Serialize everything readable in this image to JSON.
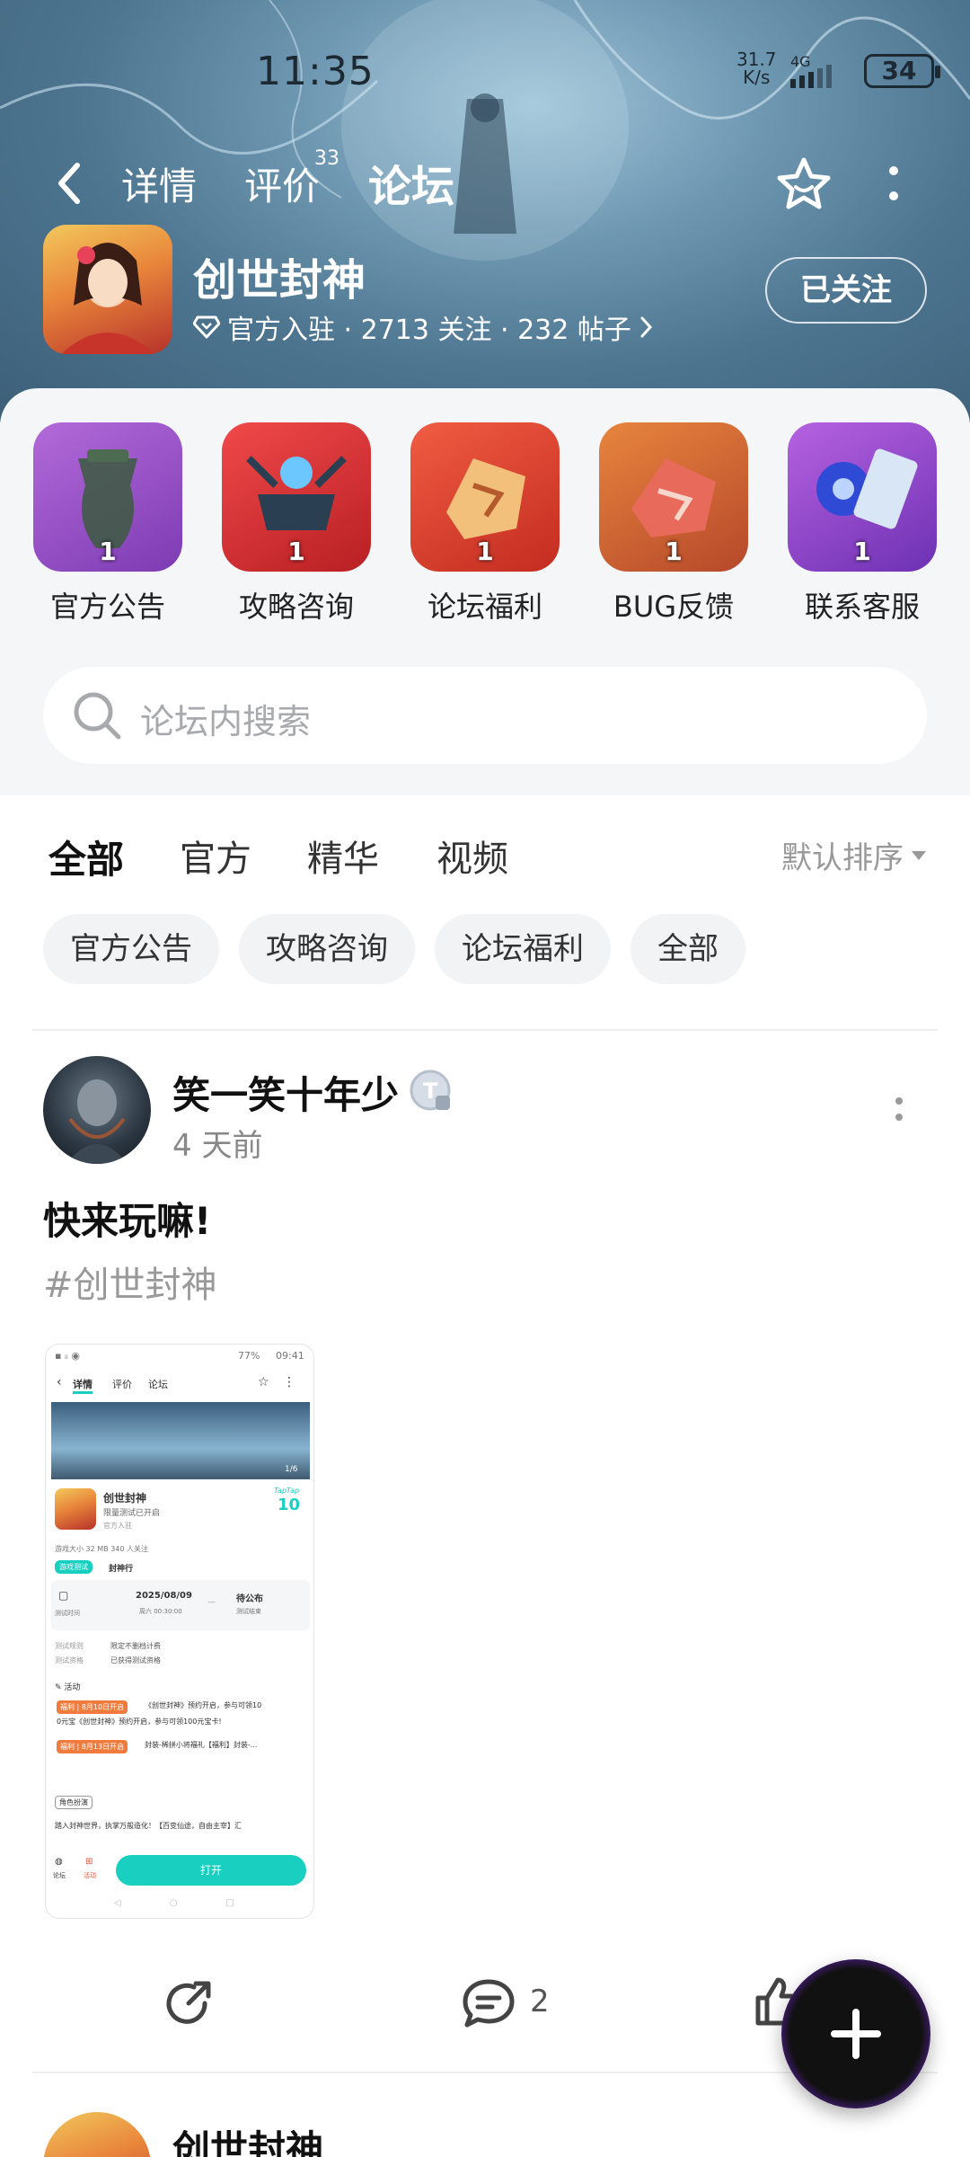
{
  "status_bar": {
    "time": "11:35",
    "net_speed_value": "31.7",
    "net_speed_unit": "K/s",
    "network_type": "4G",
    "battery": "34"
  },
  "nav": {
    "tabs": [
      {
        "label": "详情"
      },
      {
        "label": "评价",
        "badge": "33"
      },
      {
        "label": "论坛",
        "active": true
      }
    ]
  },
  "game": {
    "title": "创世封神",
    "meta": "官方入驻 · 2713 关注 · 232 帖子",
    "follow_label": "已关注"
  },
  "categories": [
    {
      "label": "官方公告",
      "count": "1"
    },
    {
      "label": "攻略咨询",
      "count": "1"
    },
    {
      "label": "论坛福利",
      "count": "1"
    },
    {
      "label": "BUG反馈",
      "count": "1"
    },
    {
      "label": "联系客服",
      "count": "1"
    }
  ],
  "search": {
    "placeholder": "论坛内搜索"
  },
  "filter_tabs": [
    {
      "label": "全部",
      "active": true
    },
    {
      "label": "官方"
    },
    {
      "label": "精华"
    },
    {
      "label": "视频"
    }
  ],
  "sort_label": "默认排序",
  "chips": [
    "官方公告",
    "攻略咨询",
    "论坛福利",
    "全部"
  ],
  "post": {
    "author": "笑一笑十年少",
    "time": "4 天前",
    "title": "快来玩嘛!",
    "tag": "#创世封神",
    "comment_count": "2",
    "screenshot": {
      "status_left": "77%",
      "status_time": "09:41",
      "tabs": [
        "详情",
        "评价",
        "论坛"
      ],
      "page_counter": "1/6",
      "game_title": "创世封神",
      "game_sub": "限量测试已开启",
      "official": "官方入驻",
      "rating_brand": "TapTap",
      "rating": "10",
      "size_info": "游戏大小 32 MB    340 人关注",
      "test_badge": "游戏测试",
      "test_name": "封神行",
      "test_date": "2025/08/09",
      "test_time": "周六 00:30:00",
      "test_label_left": "测试时间",
      "test_pending": "待公布",
      "test_label_right": "测试结束",
      "rule_label": "测试规则",
      "rule_value": "限定不删档计费",
      "qual_label": "测试资格",
      "qual_value": "已获得测试资格",
      "activity_label": "活动",
      "event1_tag": "福利 | 8月10日开启",
      "event1_text": "《创世封神》预约开启，参与可领10",
      "event1_text2": "0元宝《创世封神》预约开启，参与可领100元宝卡!",
      "event2_tag": "福利 | 8月13日开启",
      "event2_text": "封装-稀拼小将福礼【福利】封装-...",
      "role_label": "角色扮演",
      "desc": "踏入封神世界，执掌万般造化！【百变仙途，自由主宰】汇",
      "bottom_left1": "论坛",
      "bottom_left2": "活动",
      "open_label": "打开"
    }
  },
  "next_post": {
    "author": "创世封神"
  },
  "colors": {
    "accent": "#18cfc0",
    "text": "#111111",
    "muted": "#999999"
  }
}
